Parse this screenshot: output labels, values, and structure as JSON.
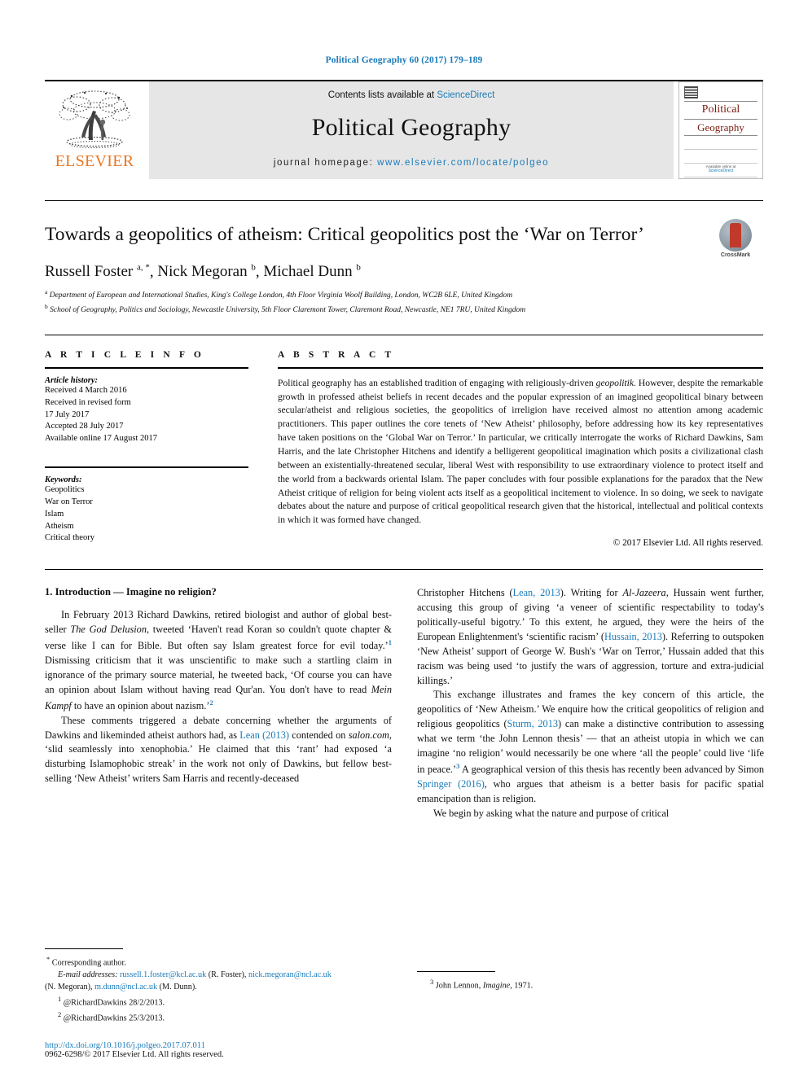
{
  "running_head": "Political Geography 60 (2017) 179–189",
  "masthead": {
    "publisher_name": "ELSEVIER",
    "contents_prefix": "Contents lists available at ",
    "contents_link": "ScienceDirect",
    "journal_title": "Political Geography",
    "homepage_prefix": "journal homepage: ",
    "homepage_url": "www.elsevier.com/locate/polgeo",
    "cover": {
      "line1": "Political",
      "line2": "Geography",
      "bottom": "Available online at",
      "bottom_link": "ScienceDirect"
    }
  },
  "article": {
    "title": "Towards a geopolitics of atheism: Critical geopolitics post the ‘War on Terror’",
    "crossmark_label": "CrossMark",
    "authors_html": "Russell Foster <sup>a, *</sup>, Nick Megoran <sup>b</sup>, Michael Dunn <sup>b</sup>",
    "affiliations": [
      "Department of European and International Studies, King's College London, 4th Floor Virginia Woolf Building, London, WC2B 6LE, United Kingdom",
      "School of Geography, Politics and Sociology, Newcastle University, 5th Floor Claremont Tower, Claremont Road, Newcastle, NE1 7RU, United Kingdom"
    ],
    "affiliation_marks": [
      "a",
      "b"
    ]
  },
  "article_info": {
    "heading": "A R T I C L E  I N F O",
    "history_label": "Article history:",
    "history": [
      "Received 4 March 2016",
      "Received in revised form",
      "17 July 2017",
      "Accepted 28 July 2017",
      "Available online 17 August 2017"
    ],
    "keywords_label": "Keywords:",
    "keywords": [
      "Geopolitics",
      "War on Terror",
      "Islam",
      "Atheism",
      "Critical theory"
    ]
  },
  "abstract": {
    "heading": "A B S T R A C T",
    "paragraph_1": "Political geography has an established tradition of engaging with religiously-driven ",
    "italic_1": "geopolitik",
    "paragraph_2": ". However, despite the remarkable growth in professed atheist beliefs in recent decades and the popular expression of an imagined geopolitical binary between secular/atheist and religious societies, the geopolitics of irreligion have received almost no attention among academic practitioners. This paper outlines the core tenets of ‘New Atheist’ philosophy, before addressing how its key representatives have taken positions on the ‘Global War on Terror.’ In particular, we critically interrogate the works of Richard Dawkins, Sam Harris, and the late Christopher Hitchens and identify a belligerent geopolitical imagination which posits a civilizational clash between an existentially-threatened secular, liberal West with responsibility to use extraordinary violence to protect itself and the world from a backwards oriental Islam. The paper concludes with four possible explanations for the paradox that the New Atheist critique of religion for being violent acts itself as a geopolitical incitement to violence. In so doing, we seek to navigate debates about the nature and purpose of critical geopolitical research given that the historical, intellectual and political contexts in which it was formed have changed.",
    "copyright": "© 2017 Elsevier Ltd. All rights reserved."
  },
  "body": {
    "section_heading": "1. Introduction — Imagine no religion?",
    "left_column": {
      "p1_a": "In February 2013 Richard Dawkins, retired biologist and author of global best-seller ",
      "p1_italic": "The God Delusion",
      "p1_b": ", tweeted ‘Haven't read Koran so couldn't quote chapter & verse like I can for Bible. But often say Islam greatest force for evil today.’",
      "p1_sup1": "1",
      "p1_c": " Dismissing criticism that it was unscientific to make such a startling claim in ignorance of the primary source material, he tweeted back, ‘Of course you can have an opinion about Islam without having read Qur'an. You don't have to read ",
      "p1_italic2": "Mein Kampf",
      "p1_d": " to have an opinion about nazism.’",
      "p1_sup2": "2",
      "p2_a": "These comments triggered a debate concerning whether the arguments of Dawkins and likeminded atheist authors had, as ",
      "p2_link": "Lean (2013)",
      "p2_b": " contended on ",
      "p2_italic": "salon.com",
      "p2_c": ", ‘slid seamlessly into xenophobia.’ He claimed that this ‘rant’ had exposed ‘a disturbing Islamophobic streak’ in the work not only of Dawkins, but fellow best-selling ‘New Atheist’ writers Sam Harris and recently-deceased"
    },
    "right_column": {
      "p3_a": "Christopher Hitchens (",
      "p3_link1": "Lean, 2013",
      "p3_b": "). Writing for ",
      "p3_italic": "Al-Jazeera",
      "p3_c": ", Hussain went further, accusing this group of giving ‘a veneer of scientific respectability to today's politically-useful bigotry.’ To this extent, he argued, they were the heirs of the European Enlightenment's ‘scientific racism’ (",
      "p3_link2": "Hussain, 2013",
      "p3_d": "). Referring to outspoken ‘New Atheist’ support of George W. Bush's ‘War on Terror,’ Hussain added that this racism was being used ‘to justify the wars of aggression, torture and extra-judicial killings.’",
      "p4_a": "This exchange illustrates and frames the key concern of this article, the geopolitics of ‘New Atheism.’ We enquire how the critical geopolitics of religion and religious geopolitics (",
      "p4_link1": "Sturm, 2013",
      "p4_b": ") can make a distinctive contribution to assessing what we term ‘the John Lennon thesis’ — that an atheist utopia in which we can imagine ‘no religion’ would necessarily be one where ‘all the people’ could live ‘life in peace.’",
      "p4_sup3": "3",
      "p4_c": " A geographical version of this thesis has recently been advanced by Simon ",
      "p4_link2": "Springer (2016)",
      "p4_d": ", who argues that atheism is a better basis for pacific spatial emancipation than is religion.",
      "p5": "We begin by asking what the nature and purpose of critical"
    }
  },
  "footnotes": {
    "left": {
      "corresponding_mark": "*",
      "corresponding": "Corresponding author.",
      "email_label": "E-mail addresses:",
      "emails": [
        {
          "address": "russell.1.foster@kcl.ac.uk",
          "name": "(R. Foster)"
        },
        {
          "address": "nick.megoran@ncl.ac.uk",
          "name": "(N. Megoran)"
        },
        {
          "address": "m.dunn@ncl.ac.uk",
          "name": "(M. Dunn)."
        }
      ],
      "notes": [
        {
          "num": "1",
          "text": "@RichardDawkins 28/2/2013."
        },
        {
          "num": "2",
          "text": "@RichardDawkins 25/3/2013."
        }
      ]
    },
    "right": {
      "num": "3",
      "text_a": "John Lennon, ",
      "text_italic": "Imagine",
      "text_b": ", 1971."
    }
  },
  "footer": {
    "doi": "http://dx.doi.org/10.1016/j.polgeo.2017.07.011",
    "issn": "0962-6298/© 2017 Elsevier Ltd. All rights reserved."
  },
  "colors": {
    "link": "#1a7bb9",
    "elsevier_orange": "#E87722",
    "cover_red": "#7b1c10",
    "band_grey": "#e6e6e6"
  }
}
